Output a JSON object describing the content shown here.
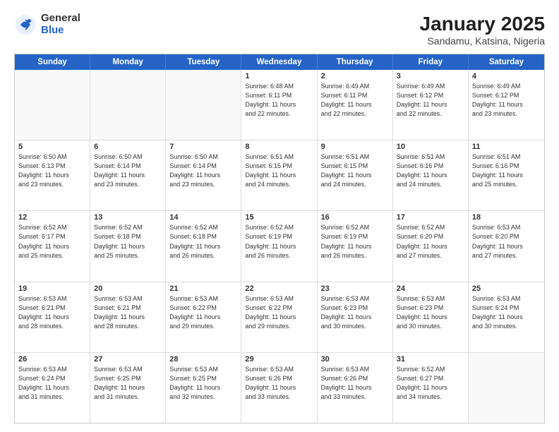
{
  "logo": {
    "general": "General",
    "blue": "Blue"
  },
  "title": "January 2025",
  "location": "Sandamu, Katsina, Nigeria",
  "days": [
    "Sunday",
    "Monday",
    "Tuesday",
    "Wednesday",
    "Thursday",
    "Friday",
    "Saturday"
  ],
  "weeks": [
    [
      {
        "day": "",
        "info": "",
        "empty": true
      },
      {
        "day": "",
        "info": "",
        "empty": true
      },
      {
        "day": "",
        "info": "",
        "empty": true
      },
      {
        "day": "1",
        "info": "Sunrise: 6:48 AM\nSunset: 6:11 PM\nDaylight: 11 hours\nand 22 minutes."
      },
      {
        "day": "2",
        "info": "Sunrise: 6:49 AM\nSunset: 6:11 PM\nDaylight: 11 hours\nand 22 minutes."
      },
      {
        "day": "3",
        "info": "Sunrise: 6:49 AM\nSunset: 6:12 PM\nDaylight: 11 hours\nand 22 minutes."
      },
      {
        "day": "4",
        "info": "Sunrise: 6:49 AM\nSunset: 6:12 PM\nDaylight: 11 hours\nand 23 minutes."
      }
    ],
    [
      {
        "day": "5",
        "info": "Sunrise: 6:50 AM\nSunset: 6:13 PM\nDaylight: 11 hours\nand 23 minutes."
      },
      {
        "day": "6",
        "info": "Sunrise: 6:50 AM\nSunset: 6:14 PM\nDaylight: 11 hours\nand 23 minutes."
      },
      {
        "day": "7",
        "info": "Sunrise: 6:50 AM\nSunset: 6:14 PM\nDaylight: 11 hours\nand 23 minutes."
      },
      {
        "day": "8",
        "info": "Sunrise: 6:51 AM\nSunset: 6:15 PM\nDaylight: 11 hours\nand 24 minutes."
      },
      {
        "day": "9",
        "info": "Sunrise: 6:51 AM\nSunset: 6:15 PM\nDaylight: 11 hours\nand 24 minutes."
      },
      {
        "day": "10",
        "info": "Sunrise: 6:51 AM\nSunset: 6:16 PM\nDaylight: 11 hours\nand 24 minutes."
      },
      {
        "day": "11",
        "info": "Sunrise: 6:51 AM\nSunset: 6:16 PM\nDaylight: 11 hours\nand 25 minutes."
      }
    ],
    [
      {
        "day": "12",
        "info": "Sunrise: 6:52 AM\nSunset: 6:17 PM\nDaylight: 11 hours\nand 25 minutes."
      },
      {
        "day": "13",
        "info": "Sunrise: 6:52 AM\nSunset: 6:18 PM\nDaylight: 11 hours\nand 25 minutes."
      },
      {
        "day": "14",
        "info": "Sunrise: 6:52 AM\nSunset: 6:18 PM\nDaylight: 11 hours\nand 26 minutes."
      },
      {
        "day": "15",
        "info": "Sunrise: 6:52 AM\nSunset: 6:19 PM\nDaylight: 11 hours\nand 26 minutes."
      },
      {
        "day": "16",
        "info": "Sunrise: 6:52 AM\nSunset: 6:19 PM\nDaylight: 11 hours\nand 26 minutes."
      },
      {
        "day": "17",
        "info": "Sunrise: 6:52 AM\nSunset: 6:20 PM\nDaylight: 11 hours\nand 27 minutes."
      },
      {
        "day": "18",
        "info": "Sunrise: 6:53 AM\nSunset: 6:20 PM\nDaylight: 11 hours\nand 27 minutes."
      }
    ],
    [
      {
        "day": "19",
        "info": "Sunrise: 6:53 AM\nSunset: 6:21 PM\nDaylight: 11 hours\nand 28 minutes."
      },
      {
        "day": "20",
        "info": "Sunrise: 6:53 AM\nSunset: 6:21 PM\nDaylight: 11 hours\nand 28 minutes."
      },
      {
        "day": "21",
        "info": "Sunrise: 6:53 AM\nSunset: 6:22 PM\nDaylight: 11 hours\nand 29 minutes."
      },
      {
        "day": "22",
        "info": "Sunrise: 6:53 AM\nSunset: 6:22 PM\nDaylight: 11 hours\nand 29 minutes."
      },
      {
        "day": "23",
        "info": "Sunrise: 6:53 AM\nSunset: 6:23 PM\nDaylight: 11 hours\nand 30 minutes."
      },
      {
        "day": "24",
        "info": "Sunrise: 6:53 AM\nSunset: 6:23 PM\nDaylight: 11 hours\nand 30 minutes."
      },
      {
        "day": "25",
        "info": "Sunrise: 6:53 AM\nSunset: 6:24 PM\nDaylight: 11 hours\nand 30 minutes."
      }
    ],
    [
      {
        "day": "26",
        "info": "Sunrise: 6:53 AM\nSunset: 6:24 PM\nDaylight: 11 hours\nand 31 minutes."
      },
      {
        "day": "27",
        "info": "Sunrise: 6:53 AM\nSunset: 6:25 PM\nDaylight: 11 hours\nand 31 minutes."
      },
      {
        "day": "28",
        "info": "Sunrise: 6:53 AM\nSunset: 6:25 PM\nDaylight: 11 hours\nand 32 minutes."
      },
      {
        "day": "29",
        "info": "Sunrise: 6:53 AM\nSunset: 6:26 PM\nDaylight: 11 hours\nand 33 minutes."
      },
      {
        "day": "30",
        "info": "Sunrise: 6:53 AM\nSunset: 6:26 PM\nDaylight: 11 hours\nand 33 minutes."
      },
      {
        "day": "31",
        "info": "Sunrise: 6:52 AM\nSunset: 6:27 PM\nDaylight: 11 hours\nand 34 minutes."
      },
      {
        "day": "",
        "info": "",
        "empty": true
      }
    ]
  ]
}
